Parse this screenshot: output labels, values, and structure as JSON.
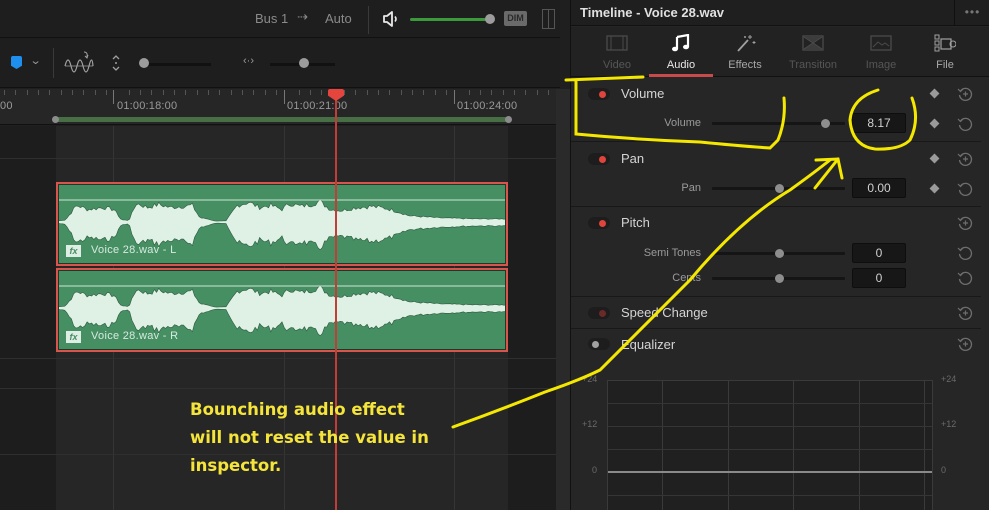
{
  "timeline": {
    "bus_label": "Bus 1",
    "bus_arrow": "⇢",
    "bus_mode": "Auto",
    "master_volume_fraction": 0.95,
    "dim_label": "DIM",
    "flag_color": "#1f8fef",
    "timecodes": [
      "00",
      "01:00:18:00",
      "01:00:21:00",
      "01:00:24:00"
    ],
    "playhead_color": "#e5453d",
    "clips": [
      {
        "name": "Voice 28.wav - L",
        "fx_label": "fx"
      },
      {
        "name": "Voice 28.wav - R",
        "fx_label": "fx"
      }
    ],
    "clip_color": "#458f63",
    "clip_selected_border": "#d9544c"
  },
  "note": {
    "text": "Bounching audio effect will not reset the value in inspector.",
    "color": "#f5e53a"
  },
  "inspector": {
    "title": "Timeline - Voice 28.wav",
    "menu_icon": "•••",
    "tabs": [
      {
        "label": "Video",
        "icon": "film-icon",
        "state": "disabled"
      },
      {
        "label": "Audio",
        "icon": "music-note-icon",
        "state": "active"
      },
      {
        "label": "Effects",
        "icon": "magic-wand-icon",
        "state": "enabled"
      },
      {
        "label": "Transition",
        "icon": "transition-icon",
        "state": "disabled"
      },
      {
        "label": "Image",
        "icon": "image-icon",
        "state": "disabled"
      },
      {
        "label": "File",
        "icon": "camera-icon",
        "state": "enabled"
      }
    ],
    "sections": {
      "volume": {
        "title": "Volume",
        "enabled": true,
        "param_label": "Volume",
        "value": "8.17",
        "slider_fraction": 0.85
      },
      "pan": {
        "title": "Pan",
        "enabled": true,
        "param_label": "Pan",
        "value": "0.00",
        "slider_fraction": 0.5
      },
      "pitch": {
        "title": "Pitch",
        "enabled": true,
        "params": [
          {
            "label": "Semi Tones",
            "value": "0",
            "slider_fraction": 0.5
          },
          {
            "label": "Cents",
            "value": "0",
            "slider_fraction": 0.5
          }
        ]
      },
      "speed_change": {
        "title": "Speed Change",
        "enabled": false
      },
      "equalizer": {
        "title": "Equalizer",
        "enabled": false
      }
    },
    "eq": {
      "y_labels": [
        "+24",
        "+12",
        "0"
      ],
      "y_range_db": [
        -24,
        24
      ]
    }
  }
}
